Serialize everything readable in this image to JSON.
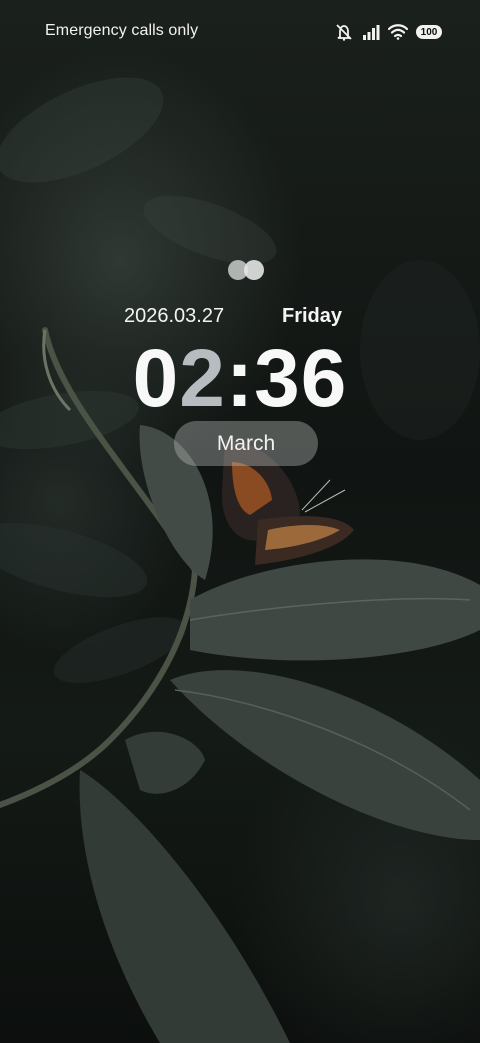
{
  "status_bar": {
    "carrier_text": "Emergency calls only",
    "battery_level": "100",
    "icons": [
      "mute-icon",
      "signal-icon",
      "wifi-icon",
      "battery-icon"
    ]
  },
  "lockscreen": {
    "date": "2026.03.27",
    "day": "Friday",
    "clock_hour_first": "0",
    "clock_hour_second": "2",
    "clock_separator": ":",
    "clock_minutes": "36",
    "month_label": "March"
  },
  "colors": {
    "text": "#f4f4f4",
    "clock_dim_digit": "#b7bcc0",
    "pill_bg": "rgba(190,195,192,0.38)"
  }
}
